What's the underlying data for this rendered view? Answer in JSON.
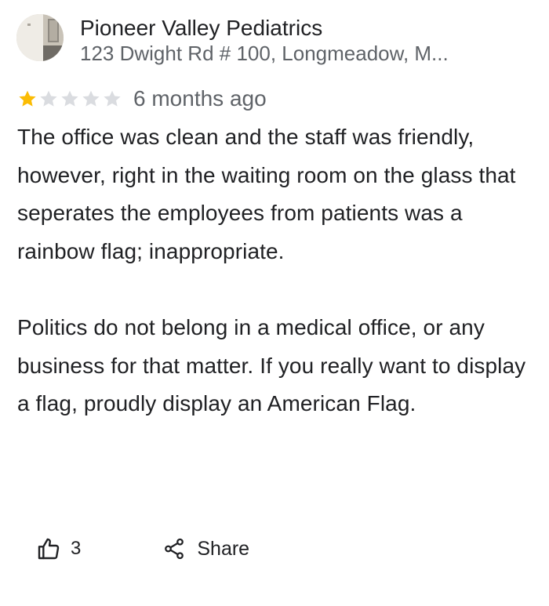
{
  "business": {
    "name": "Pioneer Valley Pediatrics",
    "address": "123 Dwight Rd # 100, Longmeadow, M..."
  },
  "review": {
    "rating": 1,
    "rating_max": 5,
    "time": "6 months ago",
    "paragraphs": [
      "The office was clean and the staff was friendly, however, right in the waiting room on the glass that seperates the employees from patients was a rainbow flag; inappropriate.",
      "Politics do not belong in a medical office, or any business for that matter. If you really want to display a flag, proudly display an American Flag."
    ]
  },
  "actions": {
    "like_count": "3",
    "share_label": "Share"
  },
  "colors": {
    "star_filled": "#fbbc04",
    "star_empty": "#dadce0",
    "primary_text": "#202124",
    "secondary_text": "#5f6368"
  },
  "icons": {
    "like": "thumbs-up-icon",
    "share": "share-icon"
  }
}
